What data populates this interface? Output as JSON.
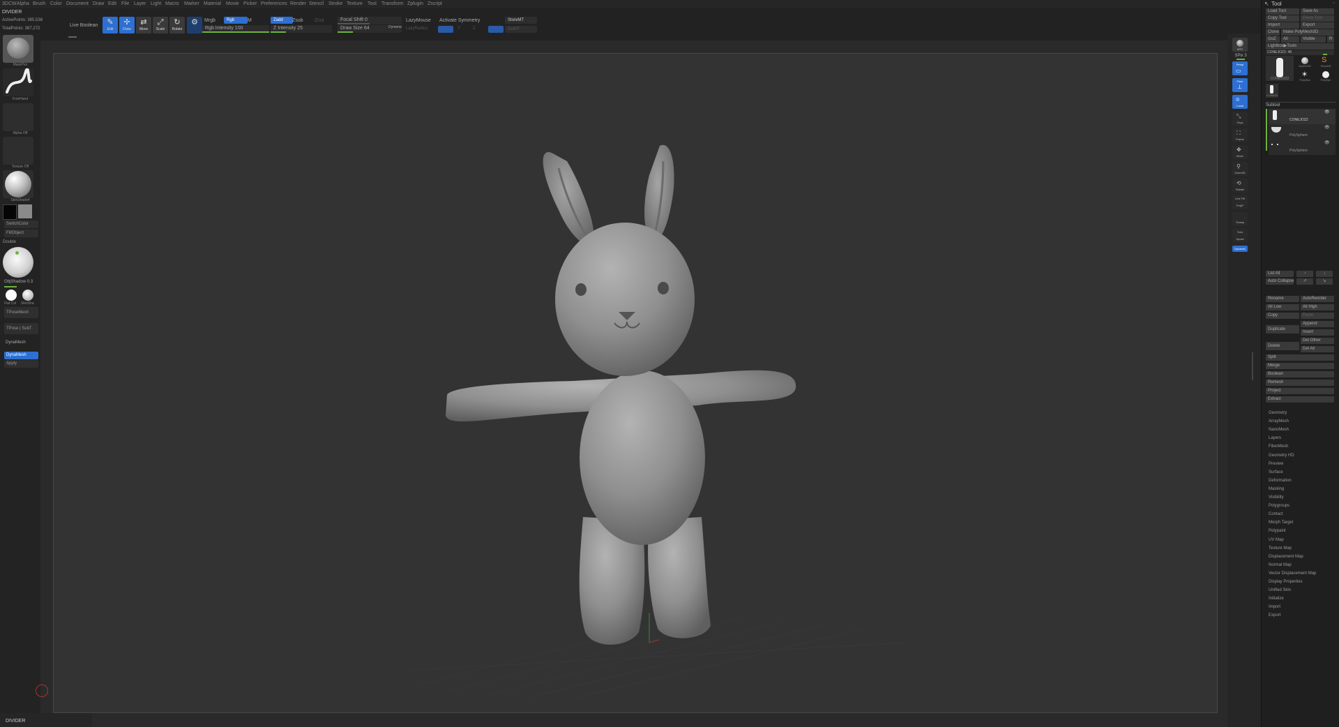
{
  "menu": [
    "3DCW",
    "Alpha",
    "Brush",
    "Color",
    "Document",
    "Draw",
    "Edit",
    "File",
    "Layer",
    "Light",
    "Macro",
    "Marker",
    "Material",
    "Movie",
    "Picker",
    "Preferences",
    "Render",
    "Stencil",
    "Stroke",
    "Texture",
    "Tool",
    "Transform",
    "Zplugin",
    "Zscript"
  ],
  "info": {
    "divider": "DIVIDER",
    "active_points": "ActivePoints: 385,538",
    "total_points": "TotalPoints: 387,272"
  },
  "toolbar": {
    "live_boolean": "Live Boolean",
    "edit": "Edit",
    "draw": "Draw",
    "move": "Move",
    "scale": "Scale",
    "rotate": "Rotate",
    "mrgb": "Mrgb",
    "rgb": "Rgb",
    "m": "M",
    "rgb_intensity": "Rgb Intensity 100",
    "rgb_intensity_value": 100,
    "zadd": "Zadd",
    "zsub": "Zsub",
    "zcut": "Zcut",
    "z_intensity": "Z Intensity 25",
    "z_intensity_value": 25,
    "focal_shift": "Focal Shift 0",
    "draw_size": "Draw Size 64",
    "dynamic": "Dynamic",
    "lazymouse": "LazyMouse",
    "lazyradius": "LazyRadius",
    "activate_symmetry": "Activate Symmetry",
    "sym_x": "X",
    "sym_y": "Y",
    "sym_z": "Z",
    "storemt": "StoreMT",
    "delmt": "DelMT"
  },
  "left_shelf": {
    "brush": "MaskPen",
    "stroke": "FreeHand",
    "alpha": "Alpha Off",
    "texture": "Texture Off",
    "material": "SkinShade4",
    "switch_color": "SwitchColor",
    "fill_object": "FillObject",
    "double": "Double",
    "obj_shadow": "ObjShadow 0.3",
    "flat_col": "Flat Col",
    "skin_sha": "SkinSha",
    "tpose_mesh": "TPoseMesh",
    "tpose_subt": "TPose | SubT",
    "dynamesh": "DynaMesh",
    "dynamesh_btn": "DynaMesh",
    "apply": "Apply"
  },
  "right_shelf": {
    "bpr": "BPR",
    "spix": "SPix 3",
    "persp": "Persp",
    "floor": "Floor",
    "local": "Local",
    "gxyz": "Gxyz",
    "frame": "Frame",
    "move": "Move",
    "zoom3d": "Zoom3D",
    "rotate": "Rotate",
    "linefill": "Line Fill",
    "polyf": "PolyF",
    "transp": "Transp",
    "solo": "Solo",
    "xpose": "Xpose",
    "dynamic": "Dynamic"
  },
  "tool_panel": {
    "title": "Tool",
    "load_tool": "Load Tool",
    "save_as": "Save As",
    "copy_tool": "Copy Tool",
    "paste_tool": "Paste Tool",
    "import": "Import",
    "export": "Export",
    "clone": "Clone",
    "make_polymesh": "Make PolyMesh3D",
    "goz": "GoZ",
    "all": "All",
    "visible": "Visible",
    "r": "R",
    "lightbox_tools": "Lightbox▶Tools",
    "current_tool": "CONEJOZ2: 48",
    "tool_thumbs": [
      "CONEJOZ2",
      "Sphere3D",
      "SimpleB",
      "PolyMes",
      "PolySph"
    ],
    "tool_thumb_small": "CONEJO",
    "subtool": "Subtool",
    "subtools": [
      "CONEJOZ2",
      "PolySphere",
      "PolySphere"
    ],
    "list_all": "List All",
    "auto_collapse": "Auto Collapse",
    "rename": "Rename",
    "autoreorder": "AutoReorder",
    "all_low": "All Low",
    "all_high": "All High",
    "copy": "Copy",
    "paste": "Paste",
    "duplicate": "Duplicate",
    "append": "Append",
    "insert": "Insert",
    "delete": "Delete",
    "del_other": "Del Other",
    "del_all": "Del All",
    "split": "Split",
    "merge": "Merge",
    "boolean": "Boolean",
    "remesh": "Remesh",
    "project": "Project",
    "extract": "Extract",
    "sections": [
      "Geometry",
      "ArrayMesh",
      "NanoMesh",
      "Layers",
      "FiberMesh",
      "Geometry HD",
      "Preview",
      "Surface",
      "Deformation",
      "Masking",
      "Visibility",
      "Polygroups",
      "Contact",
      "Morph Target",
      "Polypaint",
      "UV Map",
      "Texture Map",
      "Displacement Map",
      "Normal Map",
      "Vector Displacement Map",
      "Display Properties",
      "Unified Skin",
      "Initialize",
      "Import",
      "Export"
    ]
  },
  "status": {
    "divider": "DIVIDER"
  }
}
